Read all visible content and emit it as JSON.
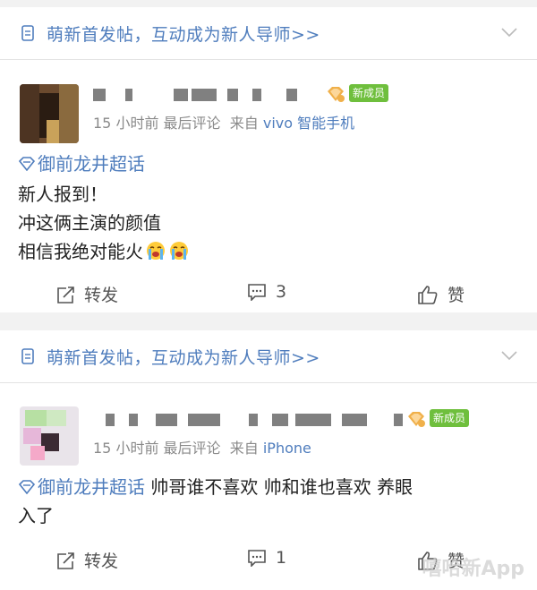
{
  "colors": {
    "accent": "#4f7dbd",
    "badge_green": "#6fbf3d",
    "meta_gray": "#8a8a8a",
    "divider": "#f2f2f2"
  },
  "banner_text": "萌新首发帖，互动成为新人导师>>",
  "posts": [
    {
      "badge": "新成员",
      "time": "15 小时前",
      "latest": "最后评论",
      "source_prefix": "来自",
      "source": "vivo 智能手机",
      "topic": "御前龙井超话",
      "lines": [
        "新人报到！",
        "冲这俩主演的颜值",
        "相信我绝对能火"
      ],
      "actions": {
        "repost": "转发",
        "comments": "3",
        "like": "赞"
      }
    },
    {
      "badge": "新成员",
      "time": "15 小时前",
      "latest": "最后评论",
      "source_prefix": "来自",
      "source": "iPhone",
      "topic": "御前龙井超话",
      "text_inline": "帅哥谁不喜欢 帅和谁也喜欢 养眼",
      "text_line2": "入了",
      "actions": {
        "repost": "转发",
        "comments": "1",
        "like": "赞"
      }
    }
  ],
  "icons": [
    "doc-icon",
    "chevron-down-icon",
    "diamond-icon",
    "super-topic-icon",
    "crying-face-emoji",
    "repost-icon",
    "comment-icon",
    "like-icon"
  ],
  "watermark": "嘻哈新App"
}
